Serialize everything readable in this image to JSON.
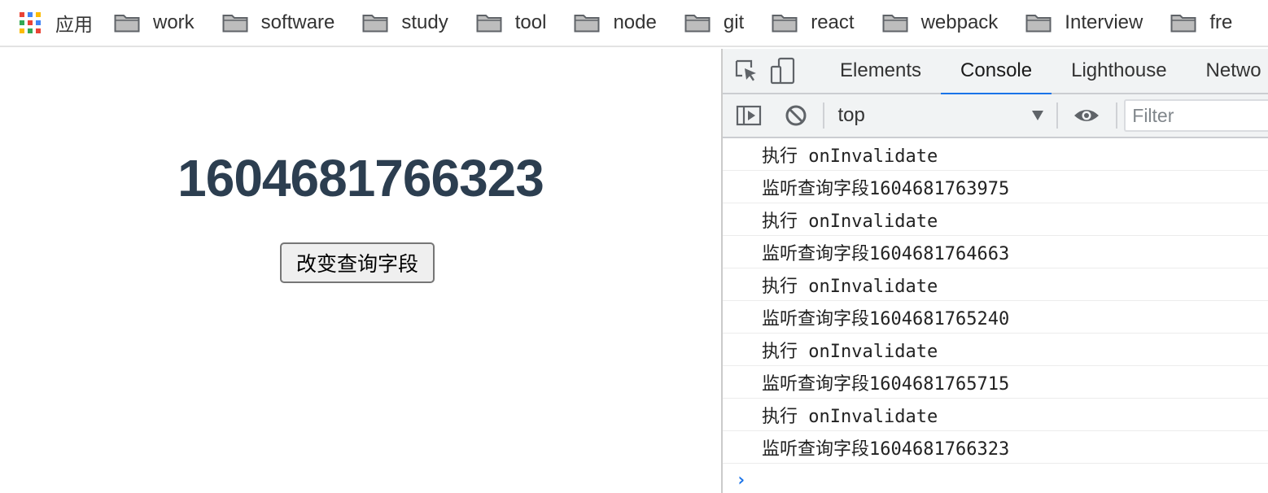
{
  "bookmarks": {
    "apps_label": "应用",
    "items": [
      {
        "label": "work"
      },
      {
        "label": "software"
      },
      {
        "label": "study"
      },
      {
        "label": "tool"
      },
      {
        "label": "node"
      },
      {
        "label": "git"
      },
      {
        "label": "react"
      },
      {
        "label": "webpack"
      },
      {
        "label": "Interview"
      },
      {
        "label": "fre"
      }
    ]
  },
  "page": {
    "big_number": "1604681766323",
    "button_label": "改变查询字段"
  },
  "devtools": {
    "tabs": [
      {
        "label": "Elements",
        "active": false
      },
      {
        "label": "Console",
        "active": true
      },
      {
        "label": "Lighthouse",
        "active": false
      },
      {
        "label": "Netwo",
        "active": false
      }
    ],
    "toolbar": {
      "context": "top",
      "filter_placeholder": "Filter"
    },
    "console_messages": [
      "执行 onInvalidate",
      "监听查询字段1604681763975",
      "执行 onInvalidate",
      "监听查询字段1604681764663",
      "执行 onInvalidate",
      "监听查询字段1604681765240",
      "执行 onInvalidate",
      "监听查询字段1604681765715",
      "执行 onInvalidate",
      "监听查询字段1604681766323"
    ],
    "prompt_symbol": "›"
  },
  "colors": {
    "accent": "#1a73e8",
    "number_text": "#2c3e50",
    "folder": "#9aa0a6"
  },
  "icons": {
    "apps": "apps-grid-icon",
    "folder": "folder-icon",
    "inspect": "inspect-element-icon",
    "device": "device-toolbar-icon",
    "sidebar": "show-sidebar-icon",
    "clear": "clear-console-icon",
    "eye": "live-expression-eye-icon"
  }
}
